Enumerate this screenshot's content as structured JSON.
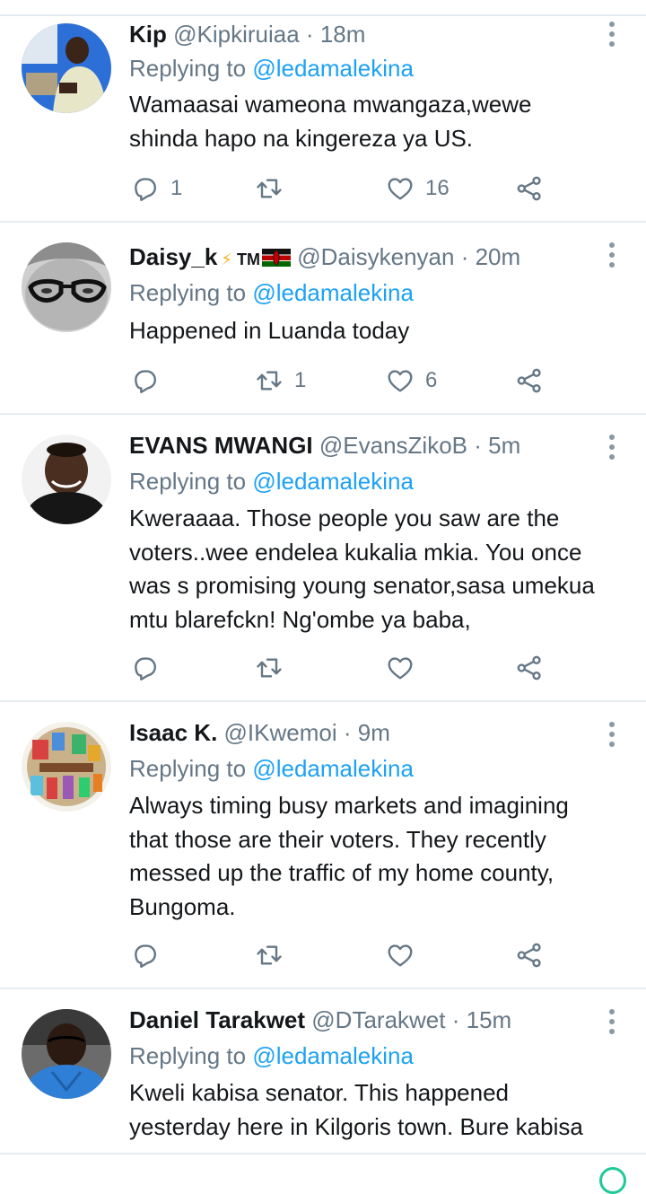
{
  "reply_prefix": "Replying to",
  "tweets": [
    {
      "name": "Kip",
      "handle": "@Kipkiruiaa",
      "sep": "·",
      "time": "18m",
      "reply_to": "@ledamalekina",
      "text": "Wamaasai wameona mwangaza,wewe\nshinda hapo na kingereza ya US.",
      "replies": "1",
      "retweets": "",
      "likes": "16"
    },
    {
      "name": "Daisy_k",
      "badge_bolt": "⚡",
      "badge_tm": "TM",
      "handle": "@Daisykenyan",
      "sep": "·",
      "time": "20m",
      "reply_to": "@ledamalekina",
      "text": "Happened in Luanda today",
      "replies": "",
      "retweets": "1",
      "likes": "6"
    },
    {
      "name": "EVANS MWANGI",
      "handle": "@EvansZikoB",
      "sep": "·",
      "time": "5m",
      "reply_to": "@ledamalekina",
      "text": "Kweraaaa. Those people you saw are the\nvoters..wee endelea kukalia mkia. You once\nwas s promising young senator,sasa umekua\nmtu blarefckn!  Ng'ombe ya baba,",
      "replies": "",
      "retweets": "",
      "likes": ""
    },
    {
      "name": "Isaac K.",
      "handle": "@IKwemoi",
      "sep": "·",
      "time": "9m",
      "reply_to": "@ledamalekina",
      "text": "Always timing busy markets and imagining\nthat those are their voters. They recently\nmessed up the traffic of my home county,\nBungoma.",
      "replies": "",
      "retweets": "",
      "likes": ""
    },
    {
      "name": "Daniel Tarakwet",
      "handle": "@DTarakwet",
      "sep": "·",
      "time": "15m",
      "reply_to": "@ledamalekina",
      "text": "Kweli kabisa senator. This happened\nyesterday here in Kilgoris town. Bure kabisa",
      "replies": "",
      "retweets": "",
      "likes": ""
    }
  ],
  "colors": {
    "accent": "#1da1f2",
    "muted": "#657786",
    "text": "#14171a",
    "divider": "#e6ecf0"
  },
  "icons": {
    "reply": "reply-icon",
    "retweet": "retweet-icon",
    "like": "like-icon",
    "share": "share-icon",
    "menu": "more-options-icon"
  }
}
